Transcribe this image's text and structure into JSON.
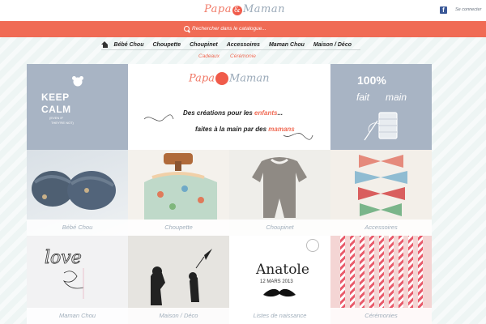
{
  "header": {
    "logo_papa": "Papa",
    "logo_amp": "&",
    "logo_maman": "Maman",
    "facebook_icon": "f",
    "login": "Se connecter"
  },
  "search": {
    "placeholder": "Rechercher dans le catalogue..."
  },
  "nav": {
    "items": [
      "Bébé Chou",
      "Choupette",
      "Choupinet",
      "Accessoires",
      "Maman Chou",
      "Maison / Déco"
    ],
    "sub_items": [
      "Cadeaux",
      "Cérémonie"
    ]
  },
  "hero": {
    "keep": "KEEP",
    "calm": "CALM",
    "even_if": "(EVEN IF",
    "theyre_not": "THEY'RE NOT)",
    "center_logo_papa": "Papa",
    "center_logo_maman": "Maman",
    "tagline1_a": "Des créations pour les ",
    "tagline1_b": "enfants",
    "tagline1_c": "...",
    "tagline2_a": "faites à la main par des ",
    "tagline2_b": "mamans",
    "fait_100": "100%",
    "fait": "fait",
    "main": "main"
  },
  "tiles": [
    {
      "label": "Bébé Chou"
    },
    {
      "label": "Choupette"
    },
    {
      "label": "Choupinet"
    },
    {
      "label": "Accessoires"
    },
    {
      "label": "Maman Chou"
    },
    {
      "label": "Maison / Déco"
    },
    {
      "label": "Listes de naissance"
    },
    {
      "label": "Cérémonies"
    }
  ],
  "listes": {
    "name": "Anatole",
    "date": "12 MARS 2013",
    "love": "love"
  },
  "colors": {
    "coral": "#f06b55",
    "slate": "#a8b4c4",
    "caption": "#a0aebb"
  }
}
